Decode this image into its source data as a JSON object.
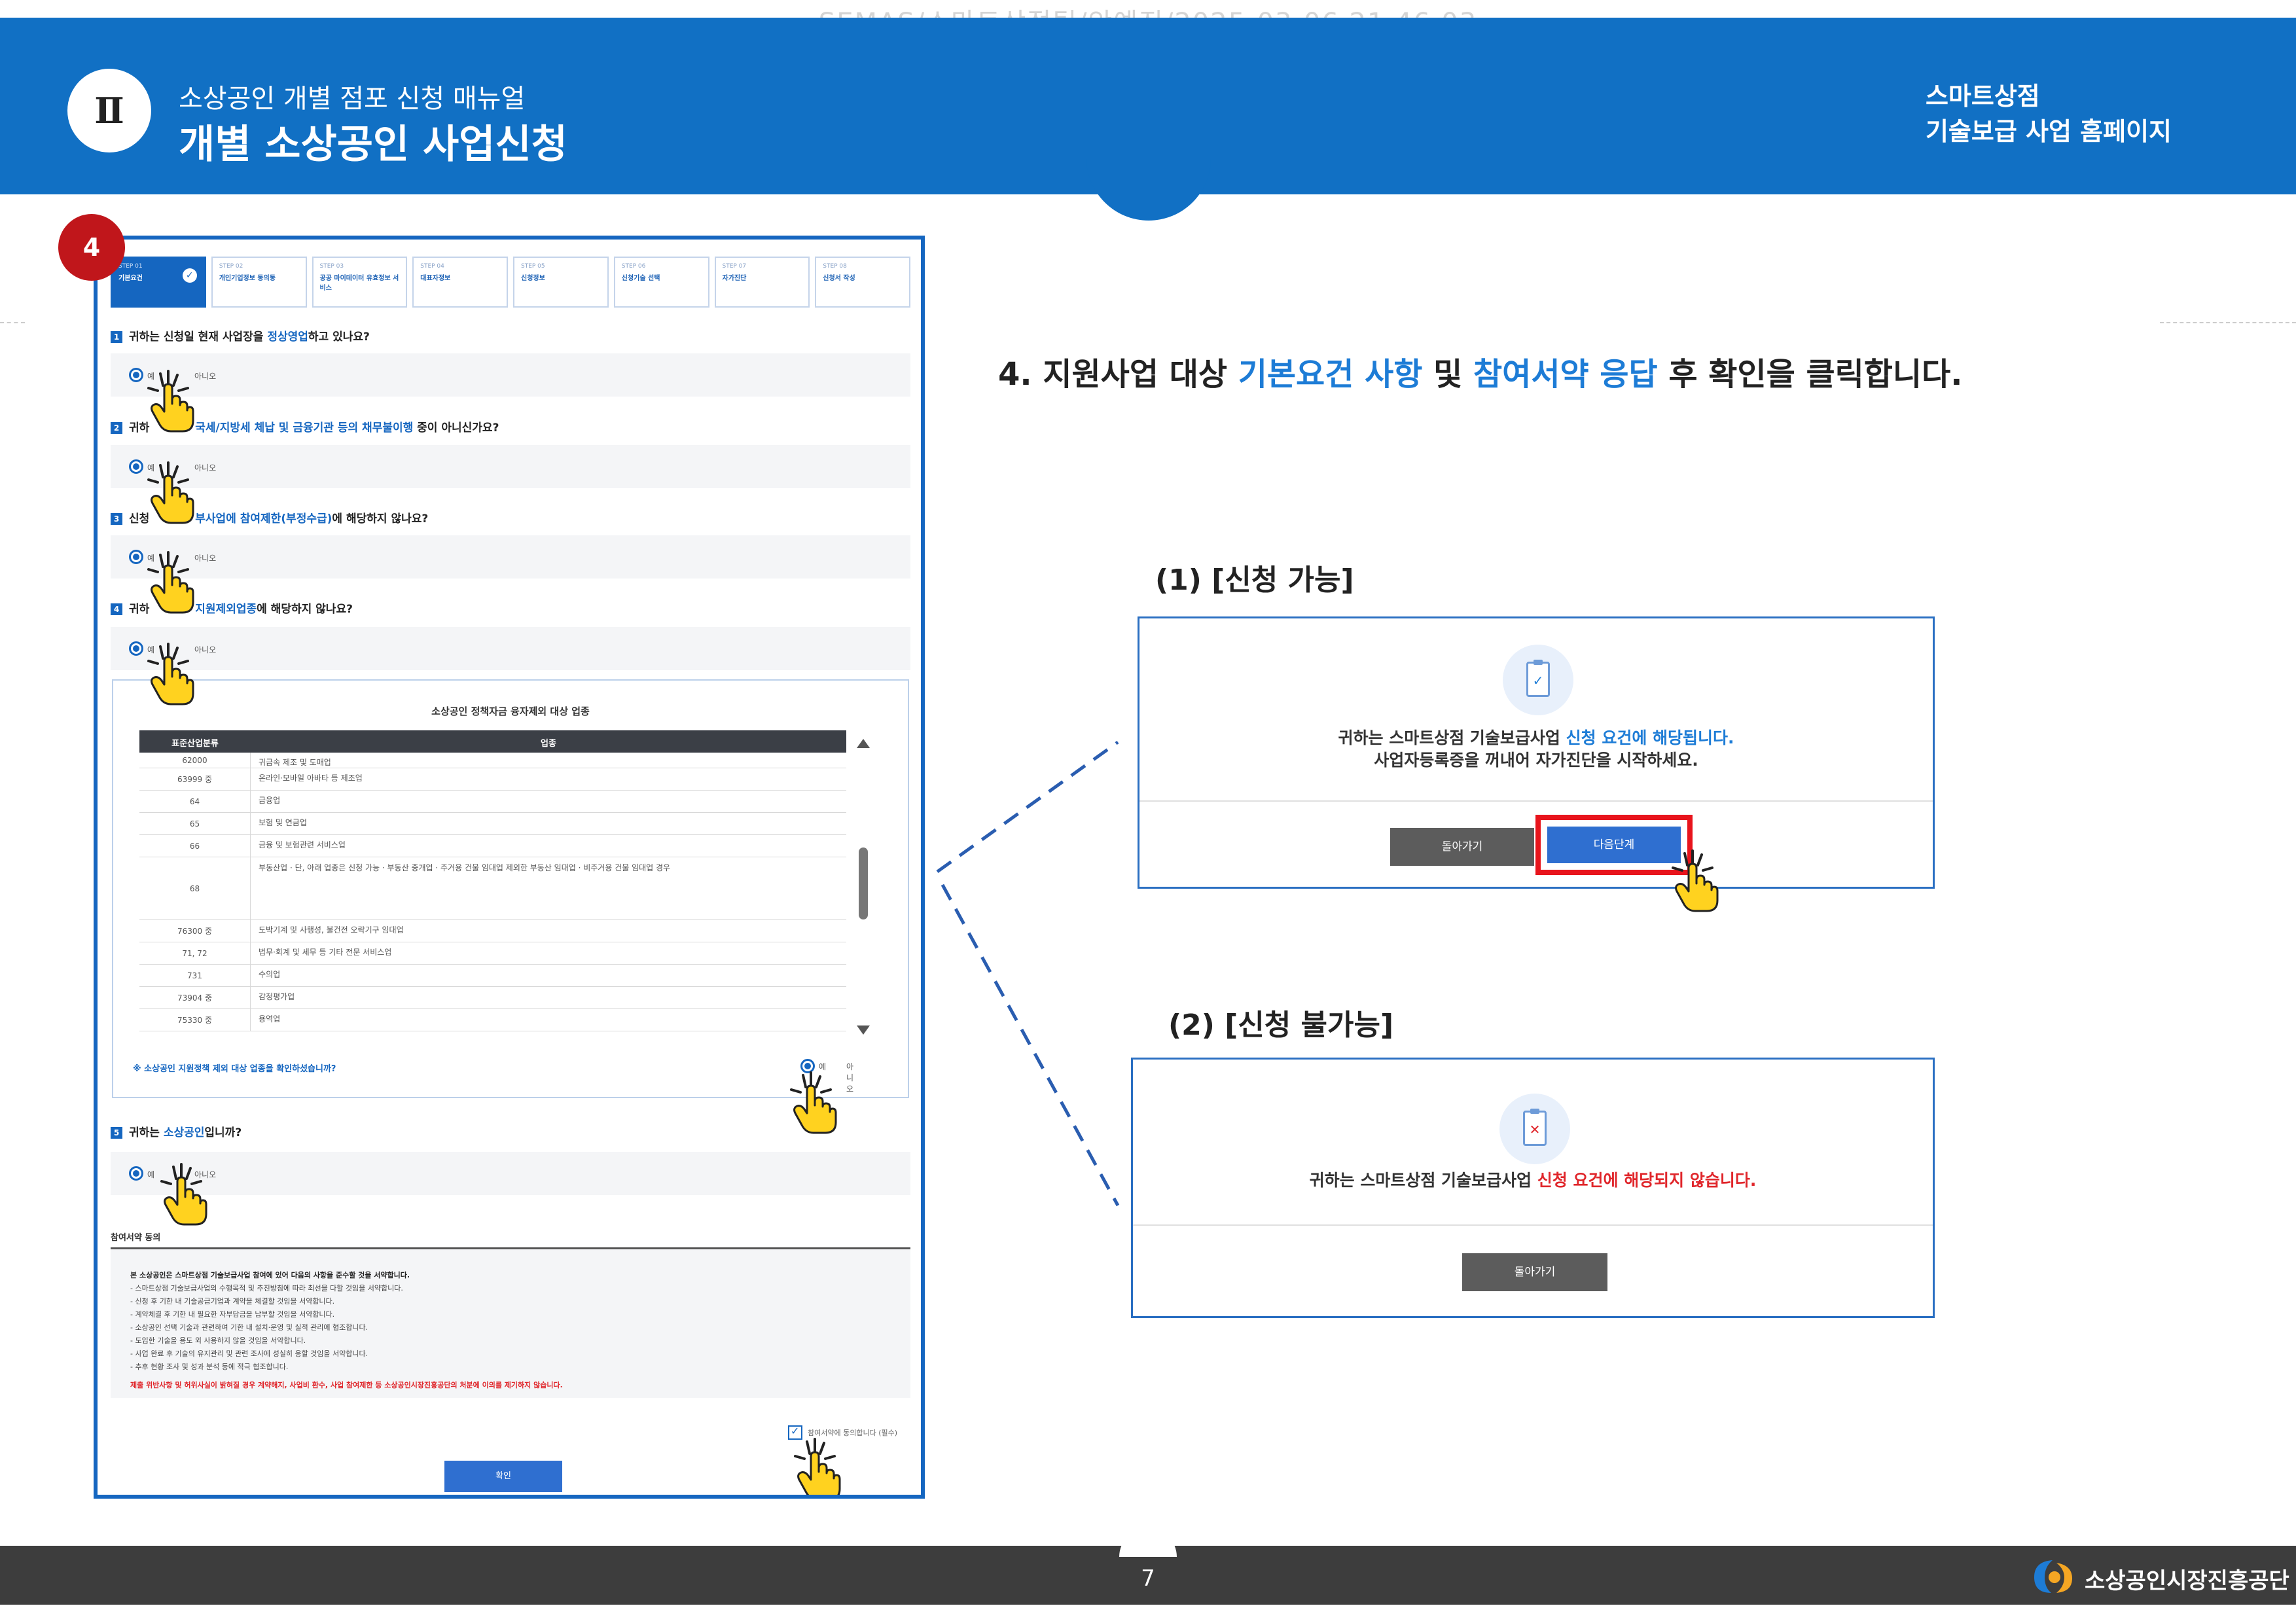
{
  "watermark": "SEMAS/스마트상점팀/안예진/2025-03-06 21:46:03",
  "header": {
    "chapter": "Ⅱ",
    "subtitle": "소상공인 개별 점포 신청 매뉴얼",
    "title": "개별 소상공인 사업신청",
    "right_line1": "스마트상점",
    "right_line2": "기술보급 사업 홈페이지"
  },
  "step_badge": "4",
  "screenshot": {
    "steps": [
      {
        "num": "STEP 01",
        "label": "기본요건",
        "active": true
      },
      {
        "num": "STEP 02",
        "label": "개인기업정보 동의동",
        "active": false
      },
      {
        "num": "STEP 03",
        "label": "공공 마이데이터 유효정보 서비스",
        "active": false
      },
      {
        "num": "STEP 04",
        "label": "대표자정보",
        "active": false
      },
      {
        "num": "STEP 05",
        "label": "신청정보",
        "active": false
      },
      {
        "num": "STEP 06",
        "label": "신청기술 선택",
        "active": false
      },
      {
        "num": "STEP 07",
        "label": "자가진단",
        "active": false
      },
      {
        "num": "STEP 08",
        "label": "신청서 작성",
        "active": false
      }
    ],
    "questions": [
      {
        "n": "1",
        "pre": "귀하는 신청일 현재 사업장을",
        "hl": "정상영업",
        "post": "하고 있나요?"
      },
      {
        "n": "2",
        "pre": "귀하",
        "hl": "국세/지방세 체납 및 금융기관 등의 채무불이행",
        "post": "중이 아니신가요?"
      },
      {
        "n": "3",
        "pre": "신청",
        "hl": "부사업에 참여제한(부정수급)",
        "post": "에 해당하지 않나요?"
      },
      {
        "n": "4",
        "pre": "귀하",
        "hl": "지원제외업종",
        "post": "에 해당하지 않나요?"
      },
      {
        "n": "5",
        "pre": "귀하는",
        "hl": "소상공인",
        "post": "입니까?"
      }
    ],
    "radio_yes": "예",
    "radio_no": "아니오",
    "table": {
      "title": "소상공인 정책자금 융자제외 대상 업종",
      "col1": "표준산업분류",
      "col2": "업종",
      "rows": [
        {
          "code": "62000",
          "name": "귀금속 제조 및 도매업"
        },
        {
          "code": "63999 중",
          "name": "온라인·모바일 아바타 등 제조업"
        },
        {
          "code": "64",
          "name": "금융업"
        },
        {
          "code": "65",
          "name": "보험 및 연금업"
        },
        {
          "code": "66",
          "name": "금융 및 보험관련 서비스업"
        },
        {
          "code": "68",
          "name": "부동산업 · 단, 아래 업종은 신청 가능 · 부동산 중개업 · 주거용 건물 임대업 제외한 부동산 임대업 · 비주거용 건물 임대업 경우"
        },
        {
          "code": "76300 중",
          "name": "도박기계 및 사행성, 불건전 오락기구 임대업"
        },
        {
          "code": "71, 72",
          "name": "법무·회계 및 세무 등 기타 전문 서비스업"
        },
        {
          "code": "731",
          "name": "수의업"
        },
        {
          "code": "73904 중",
          "name": "감정평가업"
        },
        {
          "code": "75330 중",
          "name": "용역업"
        }
      ],
      "note": "※ 소상공인 지원정책 제외 대상 업종을 확인하셨습니까?"
    },
    "agree": {
      "title": "참여서약 동의",
      "heading": "본 소상공인은 스마트상점 기술보급사업 참여에 있어 다음의 사항을 준수할 것을 서약합니다.",
      "items": [
        "- 스마트상점 기술보급사업의 수행목적 및 추진방침에 따라 최선을 다할 것임을 서약합니다.",
        "- 신청 후 기한 내 기술공급기업과 계약을 체결할 것임을 서약합니다.",
        "- 계약체결 후 기한 내 필요한 자부담금을 납부할 것임을 서약합니다.",
        "- 소상공인 선택 기술과 관련하여 기한 내 설치·운영 및 실적 관리에 협조합니다.",
        "- 도입한 기술을 용도 외 사용하지 않을 것임을 서약합니다.",
        "- 사업 완료 후 기술의 유지관리 및 관련 조사에 성실히 응할 것임을 서약합니다.",
        "- 추후 현황 조사 및 성과 분석 등에 적극 협조합니다."
      ],
      "warning": "제출 위반사항 및 허위사실이 밝혀질 경우 계약해지, 사업비 환수, 사업 참여제한 등 소상공인시장진흥공단의 처분에 이의를 제기하지 않습니다.",
      "checkbox_label": "참여서약에 동의합니다 (필수)",
      "confirm": "확인"
    }
  },
  "instruction": {
    "pre": "4. 지원사업 대상 ",
    "hl1": "기본요건 사항",
    "mid": " 및 ",
    "hl2": "참여서약 응답",
    "post": " 후 확인을 클릭합니다."
  },
  "case1": {
    "label": "(1) [신청 가능]",
    "icon_mark": "✓",
    "line1_pre": "귀하는 스마트상점 기술보급사업 ",
    "line1_hl": "신청 요건에 해당됩니다.",
    "line2": "사업자등록증을 꺼내어 자가진단을 시작하세요.",
    "back": "돌아가기",
    "next": "다음단계"
  },
  "case2": {
    "label": "(2) [신청 불가능]",
    "icon_mark": "✕",
    "line1_pre": "귀하는 스마트상점 기술보급사업 ",
    "line1_hl": "신청 요건에 해당되지 않습니다.",
    "back": "돌아가기"
  },
  "colors": {
    "brand_blue": "#1170c4",
    "accent_blue": "#1d7cd6",
    "highlight_red": "#e8141c",
    "footer": "#3d3d3d"
  },
  "footer": {
    "page": "7",
    "org": "소상공인시장진흥공단"
  }
}
